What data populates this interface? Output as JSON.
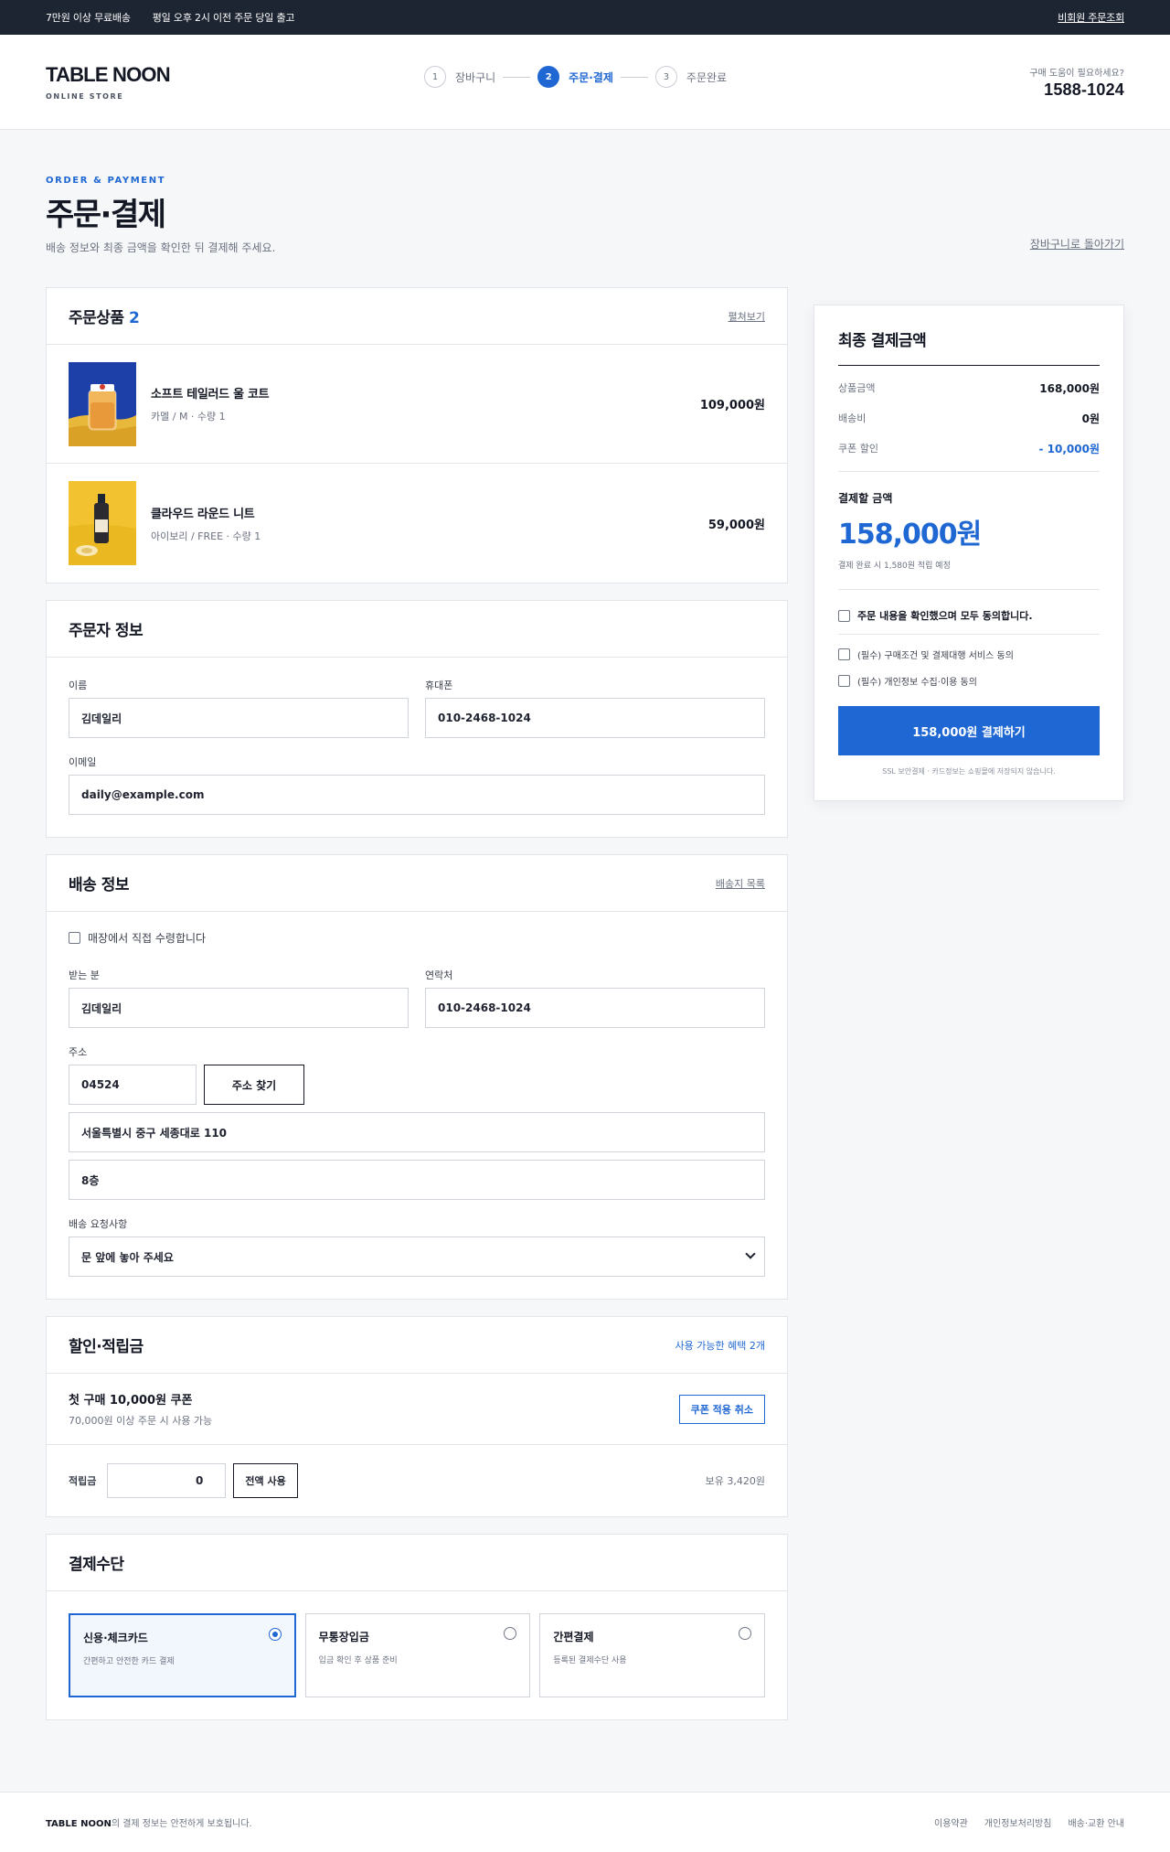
{
  "topbar": {
    "notice1": "7만원 이상 무료배송",
    "notice2": "평일 오후 2시 이전 주문 당일 출고",
    "guest_link": "비회원 주문조회"
  },
  "header": {
    "brand": "TABLE NOON",
    "brand_sub": "ONLINE STORE",
    "steps": [
      {
        "num": "1",
        "label": "장바구니"
      },
      {
        "num": "2",
        "label": "주문·결제"
      },
      {
        "num": "3",
        "label": "주문완료"
      }
    ],
    "help_question": "구매 도움이 필요하세요?",
    "help_tel": "1588-1024"
  },
  "page": {
    "eyebrow": "ORDER & PAYMENT",
    "title": "주문·결제",
    "desc": "배송 정보와 최종 금액을 확인한 뒤 결제해 주세요.",
    "back_link": "장바구니로 돌아가기"
  },
  "products": {
    "title": "주문상품",
    "count": "2",
    "toggle": "펼쳐보기",
    "items": [
      {
        "name": "소프트 테일러드 울 코트",
        "option": "카멜 / M · 수량 1",
        "price": "109,000원"
      },
      {
        "name": "클라우드 라운드 니트",
        "option": "아이보리 / FREE · 수량 1",
        "price": "59,000원"
      }
    ]
  },
  "orderer": {
    "title": "주문자 정보",
    "name_label": "이름",
    "name_value": "김데일리",
    "phone_label": "휴대폰",
    "phone_value": "010-2468-1024",
    "email_label": "이메일",
    "email_value": "daily@example.com"
  },
  "shipping": {
    "title": "배송 정보",
    "list_link": "배송지 목록",
    "pickup_label": "매장에서 직접 수령합니다",
    "receiver_label": "받는 분",
    "receiver_value": "김데일리",
    "contact_label": "연락처",
    "contact_value": "010-2468-1024",
    "address_label": "주소",
    "zipcode": "04524",
    "find_address": "주소 찾기",
    "address1": "서울특별시 중구 세종대로 110",
    "address2": "8층",
    "request_label": "배송 요청사항",
    "request_value": "문 앞에 놓아 주세요"
  },
  "discount": {
    "title": "할인·적립금",
    "available": "사용 가능한 혜택 2개",
    "coupon_name": "첫 구매 10,000원 쿠폰",
    "coupon_cond": "70,000원 이상 주문 시 사용 가능",
    "coupon_cancel": "쿠폰 적용 취소",
    "points_label": "적립금",
    "points_value": "0",
    "points_all": "전액 사용",
    "points_have": "보유 3,420원"
  },
  "payment": {
    "title": "결제수단",
    "options": [
      {
        "name": "신용·체크카드",
        "desc": "간편하고 안전한 카드 결제",
        "selected": true
      },
      {
        "name": "무통장입금",
        "desc": "입금 확인 후 상품 준비",
        "selected": false
      },
      {
        "name": "간편결제",
        "desc": "등록된 결제수단 사용",
        "selected": false
      }
    ]
  },
  "summary": {
    "title": "최종 결제금액",
    "subtotal_label": "상품금액",
    "subtotal_value": "168,000원",
    "shipping_label": "배송비",
    "shipping_value": "0원",
    "coupon_label": "쿠폰 할인",
    "coupon_value": "- 10,000원",
    "total_label": "결제할 금액",
    "total_value": "158,000원",
    "total_note": "결제 완료 시 1,580원 적립 예정",
    "agree_all": "주문 내용을 확인했으며 모두 동의합니다.",
    "agree1": "(필수) 구매조건 및 결제대행 서비스 동의",
    "agree2": "(필수) 개인정보 수집·이용 동의",
    "pay_button": "158,000원 결제하기",
    "ssl_note": "SSL 보안결제 · 카드정보는 쇼핑몰에 저장되지 않습니다."
  },
  "footer": {
    "brand": "TABLE NOON",
    "text": "의 결제 정보는 안전하게 보호됩니다.",
    "links": [
      "이용약관",
      "개인정보처리방침",
      "배송·교환 안내"
    ]
  },
  "colors": {
    "accent": "#1f67d2",
    "topbar": "#1e2532",
    "text": "#141824"
  }
}
